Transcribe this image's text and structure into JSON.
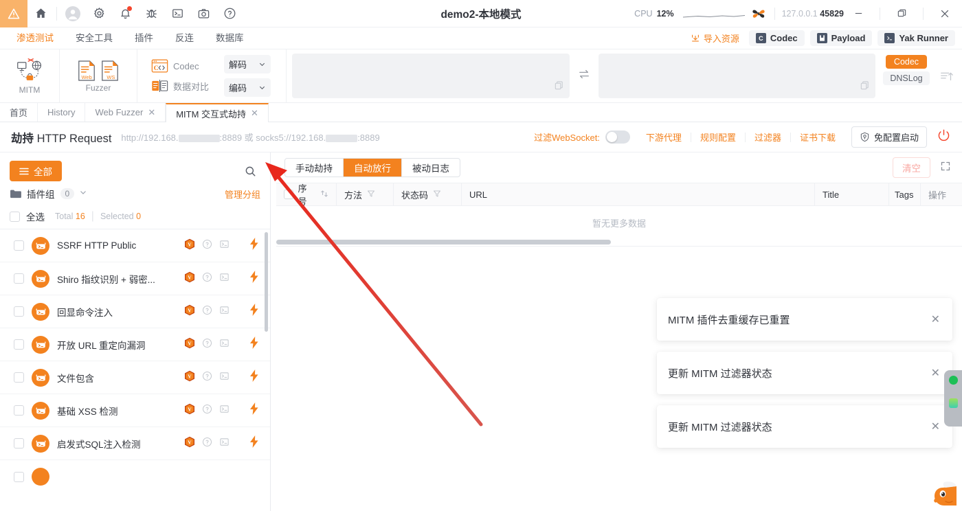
{
  "titlebar": {
    "title": "demo2-本地模式",
    "cpu_label": "CPU",
    "cpu_value": "12%",
    "host": "127.0.0.1",
    "port": "45829",
    "icons": [
      "warning-icon",
      "home-icon",
      "user-icon",
      "gear-icon",
      "bell-icon",
      "bug-icon",
      "terminal-icon",
      "camera-icon",
      "help-icon"
    ],
    "window_controls": [
      "minimize",
      "maximize",
      "close"
    ]
  },
  "menubar": {
    "items": [
      {
        "label": "渗透测试",
        "active": true
      },
      {
        "label": "安全工具",
        "active": false
      },
      {
        "label": "插件",
        "active": false
      },
      {
        "label": "反连",
        "active": false
      },
      {
        "label": "数据库",
        "active": false
      }
    ],
    "import_label": "导入资源",
    "chips": [
      {
        "label": "Codec",
        "icon": "codec-icon"
      },
      {
        "label": "Payload",
        "icon": "payload-icon"
      },
      {
        "label": "Yak Runner",
        "icon": "terminal-icon"
      }
    ]
  },
  "ribbon": {
    "mitm_label": "MITM",
    "fuzzer_label": "Fuzzer",
    "codec_label": "Codec",
    "datacompare_label": "数据对比",
    "decode_label": "解码",
    "encode_label": "编码",
    "tag_active": "Codec",
    "tag_inactive": "DNSLog"
  },
  "tabs": [
    {
      "label": "首页",
      "closable": false,
      "active": false
    },
    {
      "label": "History",
      "closable": false,
      "active": false
    },
    {
      "label": "Web Fuzzer",
      "closable": true,
      "active": false
    },
    {
      "label": "MITM 交互式劫持",
      "closable": true,
      "active": true
    }
  ],
  "pagehead": {
    "title_bold": "劫持",
    "title_rest": " HTTP Request",
    "url_part1": "http://192.168.",
    "url_part2": ":8889 或 socks5://192.168.",
    "url_part3": ":8889",
    "ws_filter_label": "过滤WebSocket:",
    "ws_filter_on": false,
    "links": [
      "下游代理",
      "规则配置",
      "过滤器",
      "证书下载"
    ],
    "start_button": "免配置启动",
    "power_icon": "power-icon"
  },
  "left_panel": {
    "all_chip": "全部",
    "search_icon": "search-icon",
    "group_label": "插件组",
    "group_count": "0",
    "manage_label": "管理分组",
    "select_all_label": "全选",
    "total_label": "Total",
    "total_value": "16",
    "selected_label": "Selected",
    "selected_value": "0",
    "plugins": [
      {
        "name": "SSRF HTTP Public"
      },
      {
        "name": "Shiro 指纹识别 + 弱密..."
      },
      {
        "name": "回显命令注入"
      },
      {
        "name": "开放 URL 重定向漏洞"
      },
      {
        "name": "文件包含"
      },
      {
        "name": "基础 XSS 检测"
      },
      {
        "name": "启发式SQL注入检测"
      }
    ]
  },
  "right_panel": {
    "segments": [
      {
        "label": "手动劫持",
        "active": false
      },
      {
        "label": "自动放行",
        "active": true
      },
      {
        "label": "被动日志",
        "active": false
      }
    ],
    "clear_button": "清空",
    "expand_icon": "expand-icon",
    "table": {
      "columns": [
        "序号",
        "方法",
        "状态码",
        "URL",
        "Title",
        "Tags",
        "操作"
      ],
      "rows": [],
      "empty_text": "暂无更多数据"
    }
  },
  "toasts": [
    {
      "message": "MITM 插件去重缓存已重置"
    },
    {
      "message": "更新 MITM 过滤器状态"
    },
    {
      "message": "更新 MITM 过滤器状态"
    }
  ],
  "colors": {
    "accent": "#f3821f",
    "danger": "#f5452c",
    "text": "#31343b",
    "muted": "#8b9099",
    "border": "#e8eaee",
    "annotation_arrow": "#e8271c"
  }
}
